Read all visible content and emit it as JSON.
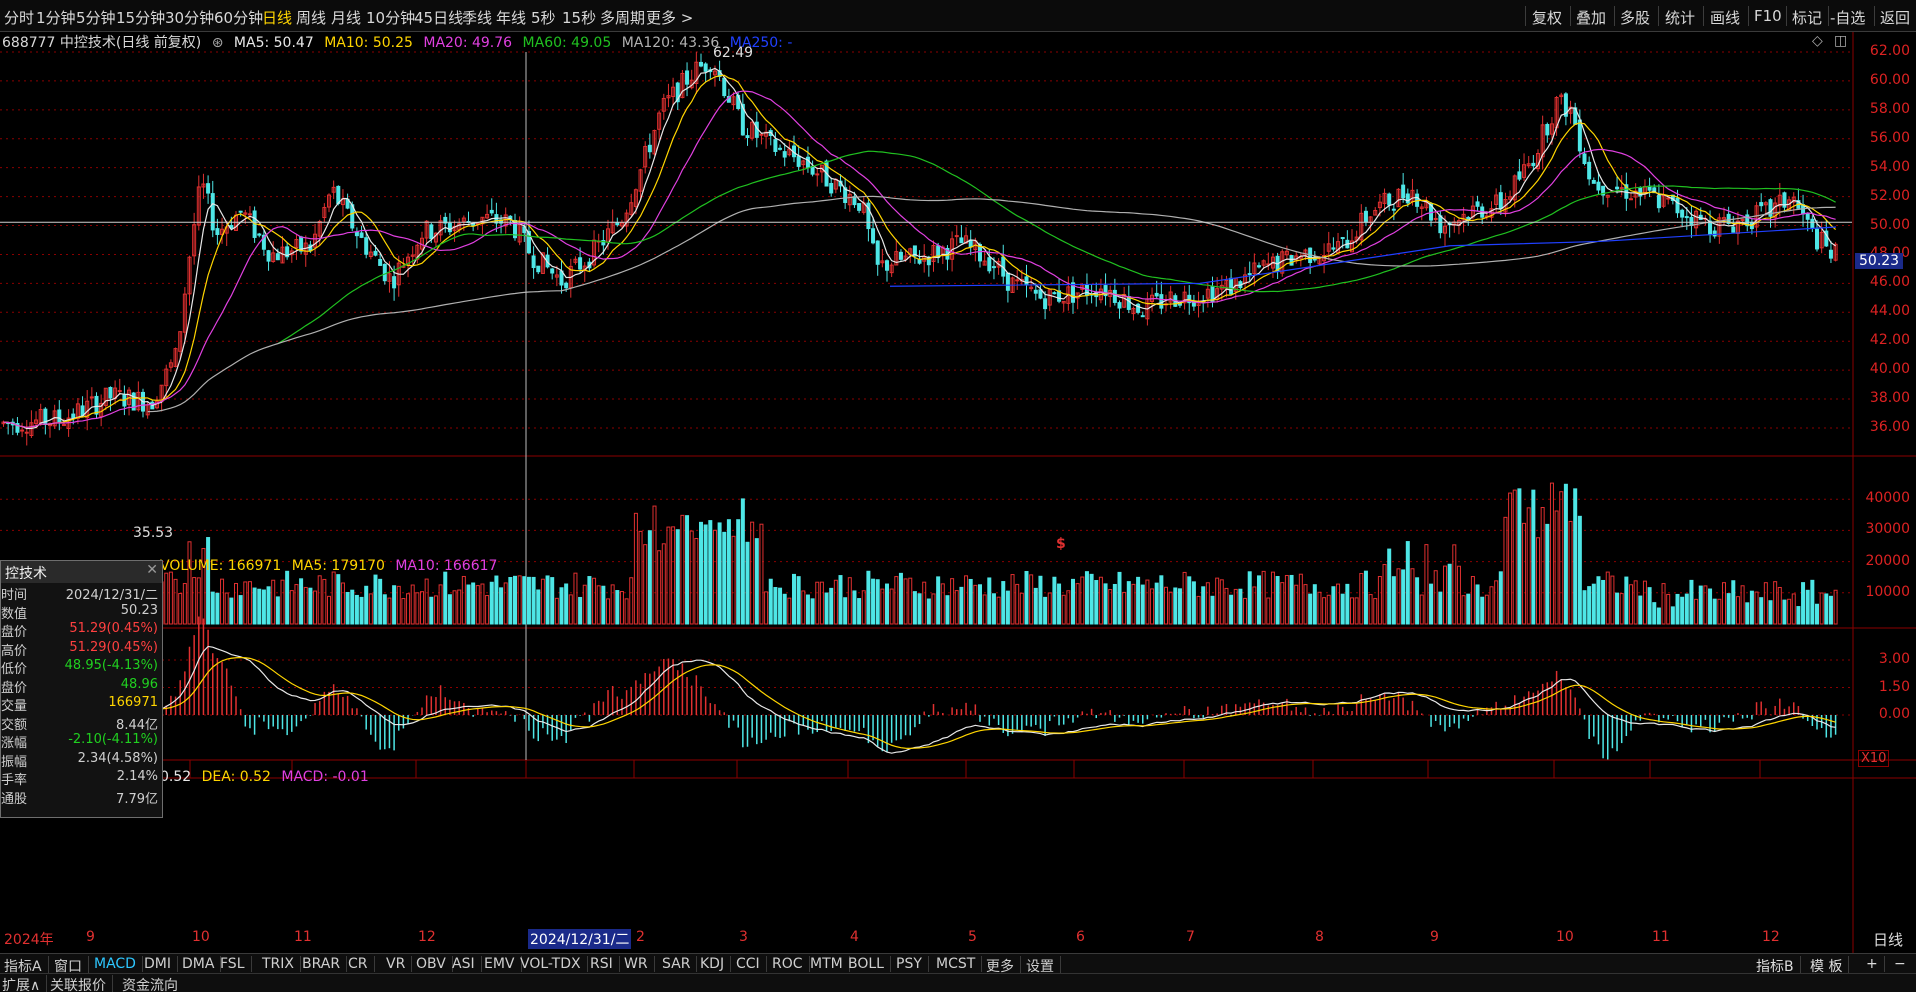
{
  "toolbar": {
    "periods": [
      "分时",
      "1分钟",
      "5分钟",
      "15分钟",
      "30分钟",
      "60分钟",
      "日线",
      "周线",
      "月线",
      "10分钟",
      "45日线",
      "季线",
      "年线",
      "5秒",
      "15秒",
      "多周期",
      "更多 >"
    ],
    "active_period": "日线",
    "right": [
      "复权",
      "叠加",
      "多股",
      "统计",
      "画线",
      "F10",
      "标记",
      "-自选",
      "返回"
    ]
  },
  "info": {
    "code_name": "688777 中控技术(日线 前复权)",
    "ma5": "MA5: 50.47",
    "ma10": "MA10: 50.25",
    "ma20": "MA20: 49.76",
    "ma60": "MA60: 49.05",
    "ma120": "MA120: 43.36",
    "ma250": "MA250: -"
  },
  "colors": {
    "up": "#e03030",
    "down": "#4ee6e6",
    "ma5": "#e8e8e8",
    "ma10": "#ffd500",
    "ma20": "#e040e0",
    "ma60": "#20c020",
    "ma120": "#b0b0b0",
    "ma250": "#2040ff",
    "grid": "#8b0000"
  },
  "price_axis": {
    "labels": [
      "62.00",
      "60.00",
      "58.00",
      "56.00",
      "54.00",
      "52.00",
      "50.00",
      "48.00",
      "46.00",
      "44.00",
      "42.00",
      "40.00",
      "38.00",
      "36.00"
    ],
    "cross_value": "50.23",
    "high_mark": "62.49",
    "low_mark": "35.53",
    "icon_marker": "$"
  },
  "volume": {
    "header_vol": "VOLUME: 166971",
    "header_ma5": "MA5: 179170",
    "header_ma10": "MA10: 166617",
    "axis": [
      "40000",
      "30000",
      "20000",
      "10000"
    ],
    "unit": "X10"
  },
  "macd": {
    "header_dif": "0.52",
    "header_dea": "DEA: 0.52",
    "header_macd": "MACD: -0.01",
    "axis": [
      "3.00",
      "1.50",
      "0.00"
    ]
  },
  "date_axis": {
    "labels": [
      "2024年",
      "9",
      "10",
      "11",
      "12",
      "2024/12/31/二",
      "2",
      "3",
      "4",
      "5",
      "6",
      "7",
      "8",
      "9",
      "10",
      "11",
      "12"
    ],
    "right_label": "日线"
  },
  "tooltip": {
    "title": "控技术",
    "rows": [
      {
        "k": "时间",
        "v": "2024/12/31/二",
        "c": "#cfcfcf"
      },
      {
        "k": "数值",
        "v": "50.23",
        "c": "#cfcfcf"
      },
      {
        "k": "盘价",
        "v": "51.29(0.45%)",
        "c": "#ff4040"
      },
      {
        "k": "高价",
        "v": "51.29(0.45%)",
        "c": "#ff4040"
      },
      {
        "k": "低价",
        "v": "48.95(-4.13%)",
        "c": "#20d020"
      },
      {
        "k": "盘价",
        "v": "48.96",
        "c": "#20d020"
      },
      {
        "k": "交量",
        "v": "166971",
        "c": "#ffd500"
      },
      {
        "k": "交额",
        "v": "8.44亿",
        "c": "#cfcfcf"
      },
      {
        "k": "涨幅",
        "v": "-2.10(-4.11%)",
        "c": "#20d020"
      },
      {
        "k": "振幅",
        "v": "2.34(4.58%)",
        "c": "#cfcfcf"
      },
      {
        "k": "手率",
        "v": "2.14%",
        "c": "#cfcfcf"
      },
      {
        "k": "通股",
        "v": "7.79亿",
        "c": "#cfcfcf"
      }
    ]
  },
  "indicator_tabs": [
    "指标A",
    "窗口",
    "MACD",
    "DMI",
    "DMA",
    "FSL",
    "TRIX",
    "BRAR",
    "CR",
    "VR",
    "OBV",
    "ASI",
    "EMV",
    "VOL-TDX",
    "RSI",
    "WR",
    "SAR",
    "KDJ",
    "CCI",
    "ROC",
    "MTM",
    "BOLL",
    "PSY",
    "MCST",
    "更多",
    "设置"
  ],
  "active_tab": "MACD",
  "right_tabs": [
    "指标B",
    "模 板",
    "+",
    "−"
  ],
  "bottom_tabs": [
    "扩展∧",
    "关联报价",
    "资金流向"
  ]
}
